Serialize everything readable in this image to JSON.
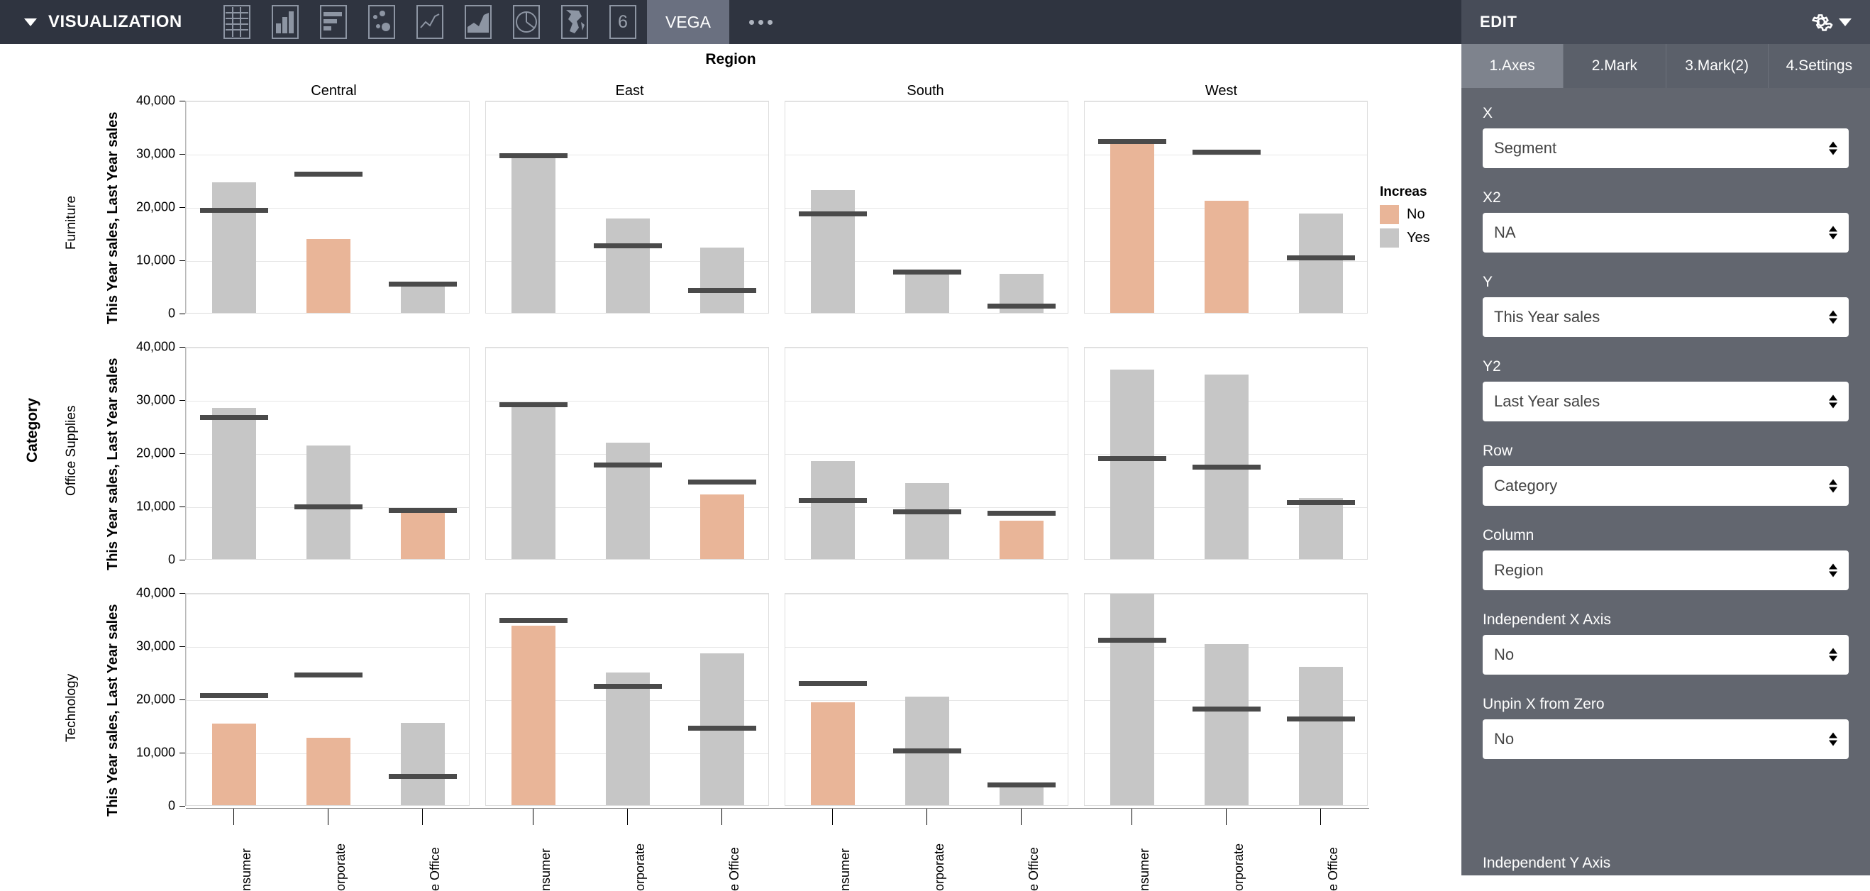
{
  "toolbar": {
    "collapse_label": "VISUALIZATION",
    "icons": [
      {
        "name": "table-icon",
        "title": "Table"
      },
      {
        "name": "bar-chart-icon",
        "title": "Bar"
      },
      {
        "name": "horizontal-bar-chart-icon",
        "title": "Horizontal Bar"
      },
      {
        "name": "scatter-plot-icon",
        "title": "Scatter"
      },
      {
        "name": "line-chart-icon",
        "title": "Line"
      },
      {
        "name": "area-chart-icon",
        "title": "Area"
      },
      {
        "name": "pie-chart-icon",
        "title": "Pie"
      },
      {
        "name": "map-icon",
        "title": "Map"
      },
      {
        "name": "six-icon",
        "title": "6"
      }
    ],
    "six_label": "6",
    "active_tab": "VEGA",
    "more_label": "..."
  },
  "edit_panel": {
    "title": "EDIT",
    "gear_icon": "gear-icon",
    "tabs": [
      {
        "label": "1.Axes",
        "active": true
      },
      {
        "label": "2.Mark",
        "active": false
      },
      {
        "label": "3.Mark(2)",
        "active": false
      },
      {
        "label": "4.Settings",
        "active": false
      }
    ],
    "fields": [
      {
        "label": "X",
        "value": "Segment"
      },
      {
        "label": "X2",
        "value": "NA"
      },
      {
        "label": "Y",
        "value": "This Year sales"
      },
      {
        "label": "Y2",
        "value": "Last Year sales"
      },
      {
        "label": "Row",
        "value": "Category"
      },
      {
        "label": "Column",
        "value": "Region"
      },
      {
        "label": "Independent X Axis",
        "value": "No"
      },
      {
        "label": "Unpin X from Zero",
        "value": "No"
      }
    ],
    "cut_off_label": "Independent Y Axis"
  },
  "chart_data": {
    "type": "bar",
    "title": "Region",
    "xlabel": "",
    "ylabel": "This Year sales, Last Year sales",
    "row_facet_title": "Category",
    "col_facet_title": "Region",
    "ylim": [
      0,
      40000
    ],
    "yticks": [
      0,
      10000,
      20000,
      30000,
      40000
    ],
    "ytick_labels": [
      "0",
      "10,000",
      "20,000",
      "30,000",
      "40,000"
    ],
    "grid": true,
    "columns": [
      "Central",
      "East",
      "South",
      "West"
    ],
    "rows": [
      "Furniture",
      "Office Supplies",
      "Technology"
    ],
    "categories": [
      "Consumer",
      "Corporate",
      "Home Office"
    ],
    "xtick_labels": [
      "nsumer",
      "orporate",
      "e Office"
    ],
    "legend": {
      "title": "Increase",
      "title_display": "Increas",
      "position": "right",
      "entries": [
        {
          "label": "No",
          "color": "#e9b598"
        },
        {
          "label": "Yes",
          "color": "#c6c6c6"
        }
      ]
    },
    "rule_color": "#4a4a4a",
    "series": [
      {
        "name": "This Year sales",
        "encoding": "bar"
      },
      {
        "name": "Last Year sales",
        "encoding": "rule"
      }
    ],
    "panels": [
      {
        "row": "Furniture",
        "column": "Central",
        "bars": [
          {
            "category": "Consumer",
            "this_year": 24500,
            "last_year": 19600,
            "increase": "Yes"
          },
          {
            "category": "Corporate",
            "this_year": 13900,
            "last_year": 26400,
            "increase": "No"
          },
          {
            "category": "Home Office",
            "this_year": 5800,
            "last_year": 5700,
            "increase": "Yes"
          }
        ]
      },
      {
        "row": "Furniture",
        "column": "East",
        "bars": [
          {
            "category": "Consumer",
            "this_year": 29600,
            "last_year": 29900,
            "increase": "Yes"
          },
          {
            "category": "Corporate",
            "this_year": 17800,
            "last_year": 12900,
            "increase": "Yes"
          },
          {
            "category": "Home Office",
            "this_year": 12300,
            "last_year": 4500,
            "increase": "Yes"
          }
        ]
      },
      {
        "row": "Furniture",
        "column": "South",
        "bars": [
          {
            "category": "Consumer",
            "this_year": 23100,
            "last_year": 18900,
            "increase": "Yes"
          },
          {
            "category": "Corporate",
            "this_year": 7700,
            "last_year": 8000,
            "increase": "Yes"
          },
          {
            "category": "Home Office",
            "this_year": 7300,
            "last_year": 1600,
            "increase": "Yes"
          }
        ]
      },
      {
        "row": "Furniture",
        "column": "West",
        "bars": [
          {
            "category": "Consumer",
            "this_year": 31900,
            "last_year": 32500,
            "increase": "No"
          },
          {
            "category": "Corporate",
            "this_year": 21100,
            "last_year": 30500,
            "increase": "No"
          },
          {
            "category": "Home Office",
            "this_year": 18700,
            "last_year": 10700,
            "increase": "Yes"
          }
        ]
      },
      {
        "row": "Office Supplies",
        "column": "Central",
        "bars": [
          {
            "category": "Consumer",
            "this_year": 28400,
            "last_year": 27000,
            "increase": "Yes"
          },
          {
            "category": "Corporate",
            "this_year": 21400,
            "last_year": 10100,
            "increase": "Yes"
          },
          {
            "category": "Home Office",
            "this_year": 9300,
            "last_year": 9500,
            "increase": "No"
          }
        ]
      },
      {
        "row": "Office Supplies",
        "column": "East",
        "bars": [
          {
            "category": "Consumer",
            "this_year": 29200,
            "last_year": 29400,
            "increase": "Yes"
          },
          {
            "category": "Corporate",
            "this_year": 21900,
            "last_year": 18000,
            "increase": "Yes"
          },
          {
            "category": "Home Office",
            "this_year": 12100,
            "last_year": 14800,
            "increase": "No"
          }
        ]
      },
      {
        "row": "Office Supplies",
        "column": "South",
        "bars": [
          {
            "category": "Consumer",
            "this_year": 18400,
            "last_year": 11300,
            "increase": "Yes"
          },
          {
            "category": "Corporate",
            "this_year": 14300,
            "last_year": 9200,
            "increase": "Yes"
          },
          {
            "category": "Home Office",
            "this_year": 7200,
            "last_year": 8900,
            "increase": "No"
          }
        ]
      },
      {
        "row": "Office Supplies",
        "column": "West",
        "bars": [
          {
            "category": "Consumer",
            "this_year": 35600,
            "last_year": 19200,
            "increase": "Yes"
          },
          {
            "category": "Corporate",
            "this_year": 34700,
            "last_year": 17600,
            "increase": "Yes"
          },
          {
            "category": "Home Office",
            "this_year": 11500,
            "last_year": 11000,
            "increase": "Yes"
          }
        ]
      },
      {
        "row": "Technology",
        "column": "Central",
        "bars": [
          {
            "category": "Consumer",
            "this_year": 15400,
            "last_year": 21000,
            "increase": "No"
          },
          {
            "category": "Corporate",
            "this_year": 12700,
            "last_year": 24800,
            "increase": "No"
          },
          {
            "category": "Home Office",
            "this_year": 15500,
            "last_year": 5800,
            "increase": "Yes"
          }
        ]
      },
      {
        "row": "Technology",
        "column": "East",
        "bars": [
          {
            "category": "Consumer",
            "this_year": 33700,
            "last_year": 35100,
            "increase": "No"
          },
          {
            "category": "Corporate",
            "this_year": 24900,
            "last_year": 22700,
            "increase": "Yes"
          },
          {
            "category": "Home Office",
            "this_year": 28500,
            "last_year": 14800,
            "increase": "Yes"
          }
        ]
      },
      {
        "row": "Technology",
        "column": "South",
        "bars": [
          {
            "category": "Consumer",
            "this_year": 19400,
            "last_year": 23200,
            "increase": "No"
          },
          {
            "category": "Corporate",
            "this_year": 20400,
            "last_year": 10500,
            "increase": "Yes"
          },
          {
            "category": "Home Office",
            "this_year": 4300,
            "last_year": 4100,
            "increase": "Yes"
          }
        ]
      },
      {
        "row": "Technology",
        "column": "West",
        "bars": [
          {
            "category": "Consumer",
            "this_year": 39700,
            "last_year": 31400,
            "increase": "Yes"
          },
          {
            "category": "Corporate",
            "this_year": 30300,
            "last_year": 18400,
            "increase": "Yes"
          },
          {
            "category": "Home Office",
            "this_year": 26000,
            "last_year": 16600,
            "increase": "Yes"
          }
        ]
      }
    ]
  }
}
